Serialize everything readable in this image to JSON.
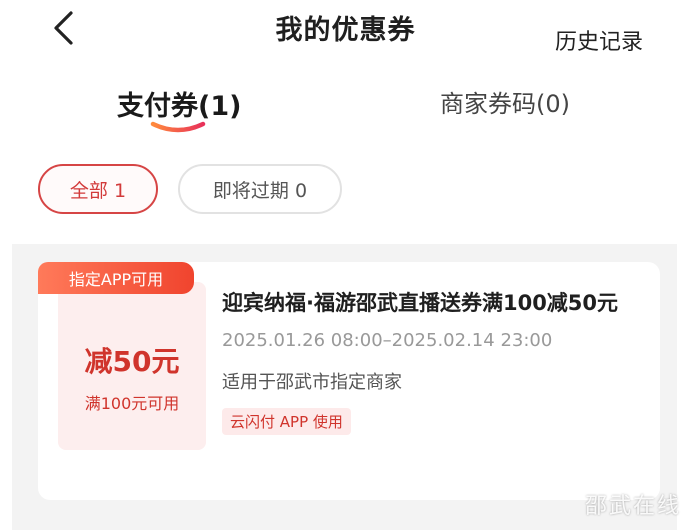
{
  "header": {
    "title": "我的优惠券",
    "history_label": "历史记录"
  },
  "tabs": [
    {
      "label": "支付券(1)",
      "active": true
    },
    {
      "label": "商家券码(0)",
      "active": false
    }
  ],
  "filters": [
    {
      "label": "全部 1",
      "active": true
    },
    {
      "label": "即将过期 0",
      "active": false
    }
  ],
  "coupon": {
    "badge": "指定APP可用",
    "amount": "减50元",
    "condition": "满100元可用",
    "title": "迎宾纳福·福游邵武直播送券满100减50元",
    "validity": "2025.01.26 08:00–2025.02.14 23:00",
    "scope": "适用于邵武市指定商家",
    "tag": "云闪付 APP 使用"
  },
  "watermark": "邵武在线",
  "colors": {
    "accent": "#d0342c",
    "badge_start": "#ff7a5a",
    "badge_end": "#f0442e",
    "list_bg": "#f3f3f3"
  }
}
